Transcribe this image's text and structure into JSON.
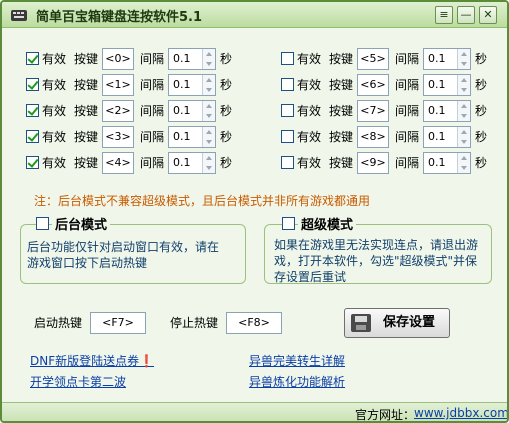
{
  "window": {
    "title": "简单百宝箱键盘连按软件5.1",
    "buttons": {
      "menu": "≡",
      "minimize": "—",
      "close": "✕"
    }
  },
  "labels": {
    "enabled": "有效",
    "key": "按键",
    "interval": "间隔",
    "seconds": "秒"
  },
  "rows_left": [
    {
      "checked": true,
      "key": "<0>",
      "interval": "0.1"
    },
    {
      "checked": true,
      "key": "<1>",
      "interval": "0.1"
    },
    {
      "checked": true,
      "key": "<2>",
      "interval": "0.1"
    },
    {
      "checked": true,
      "key": "<3>",
      "interval": "0.1"
    },
    {
      "checked": true,
      "key": "<4>",
      "interval": "0.1"
    }
  ],
  "rows_right": [
    {
      "checked": false,
      "key": "<5>",
      "interval": "0.1"
    },
    {
      "checked": false,
      "key": "<6>",
      "interval": "0.1"
    },
    {
      "checked": false,
      "key": "<7>",
      "interval": "0.1"
    },
    {
      "checked": false,
      "key": "<8>",
      "interval": "0.1"
    },
    {
      "checked": false,
      "key": "<9>",
      "interval": "0.1"
    }
  ],
  "note": "注：后台模式不兼容超级模式，且后台模式并非所有游戏都通用",
  "background_mode": {
    "title": "后台模式",
    "checked": false,
    "desc1": "后台功能仅针对启动窗口有效，请在",
    "desc2": "游戏窗口按下启动热键"
  },
  "super_mode": {
    "title": "超级模式",
    "checked": false,
    "desc1": "如果在游戏里无法实现连点，请退出游",
    "desc2": "戏，打开本软件，勾选\"超级模式\"并保",
    "desc3": "存设置后重试"
  },
  "hotkeys": {
    "start_label": "启动热键",
    "start_value": "<F7>",
    "stop_label": "停止热键",
    "stop_value": "<F8>"
  },
  "save_button": "保存设置",
  "links": {
    "dnf": "DNF新版登陆送点券❗",
    "card": "开学领点卡第二波",
    "pet_rebirth": "异兽完美转生详解",
    "pet_refine": "异兽炼化功能解析"
  },
  "status": {
    "label": "官方网址：",
    "url": "www.jdbbx.com"
  },
  "colors": {
    "frame": "#5a8c3a",
    "background": "#f0f7ea",
    "note": "#c85b00",
    "link": "#0a3ea8"
  }
}
